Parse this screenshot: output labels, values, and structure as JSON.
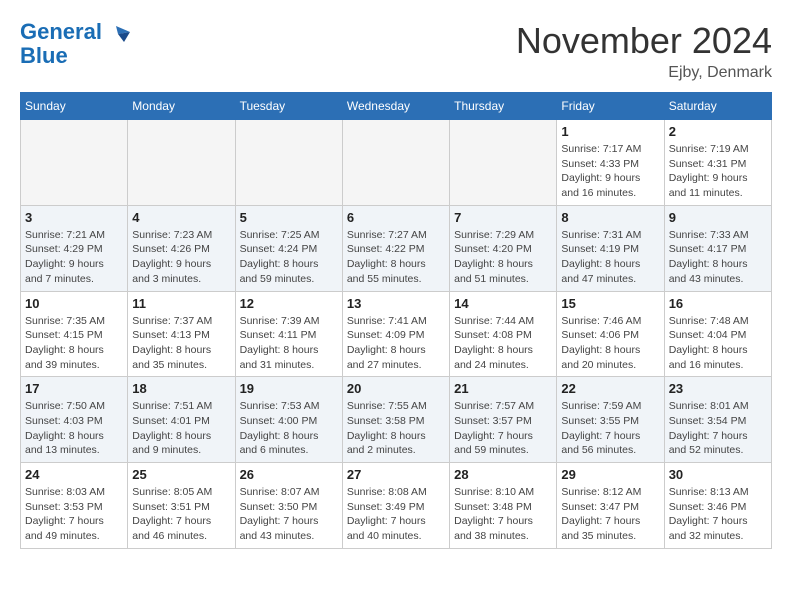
{
  "logo": {
    "line1": "General",
    "line2": "Blue"
  },
  "title": "November 2024",
  "location": "Ejby, Denmark",
  "days_of_week": [
    "Sunday",
    "Monday",
    "Tuesday",
    "Wednesday",
    "Thursday",
    "Friday",
    "Saturday"
  ],
  "weeks": [
    [
      {
        "day": "",
        "info": "",
        "empty": true
      },
      {
        "day": "",
        "info": "",
        "empty": true
      },
      {
        "day": "",
        "info": "",
        "empty": true
      },
      {
        "day": "",
        "info": "",
        "empty": true
      },
      {
        "day": "",
        "info": "",
        "empty": true
      },
      {
        "day": "1",
        "info": "Sunrise: 7:17 AM\nSunset: 4:33 PM\nDaylight: 9 hours and 16 minutes."
      },
      {
        "day": "2",
        "info": "Sunrise: 7:19 AM\nSunset: 4:31 PM\nDaylight: 9 hours and 11 minutes."
      }
    ],
    [
      {
        "day": "3",
        "info": "Sunrise: 7:21 AM\nSunset: 4:29 PM\nDaylight: 9 hours and 7 minutes."
      },
      {
        "day": "4",
        "info": "Sunrise: 7:23 AM\nSunset: 4:26 PM\nDaylight: 9 hours and 3 minutes."
      },
      {
        "day": "5",
        "info": "Sunrise: 7:25 AM\nSunset: 4:24 PM\nDaylight: 8 hours and 59 minutes."
      },
      {
        "day": "6",
        "info": "Sunrise: 7:27 AM\nSunset: 4:22 PM\nDaylight: 8 hours and 55 minutes."
      },
      {
        "day": "7",
        "info": "Sunrise: 7:29 AM\nSunset: 4:20 PM\nDaylight: 8 hours and 51 minutes."
      },
      {
        "day": "8",
        "info": "Sunrise: 7:31 AM\nSunset: 4:19 PM\nDaylight: 8 hours and 47 minutes."
      },
      {
        "day": "9",
        "info": "Sunrise: 7:33 AM\nSunset: 4:17 PM\nDaylight: 8 hours and 43 minutes."
      }
    ],
    [
      {
        "day": "10",
        "info": "Sunrise: 7:35 AM\nSunset: 4:15 PM\nDaylight: 8 hours and 39 minutes."
      },
      {
        "day": "11",
        "info": "Sunrise: 7:37 AM\nSunset: 4:13 PM\nDaylight: 8 hours and 35 minutes."
      },
      {
        "day": "12",
        "info": "Sunrise: 7:39 AM\nSunset: 4:11 PM\nDaylight: 8 hours and 31 minutes."
      },
      {
        "day": "13",
        "info": "Sunrise: 7:41 AM\nSunset: 4:09 PM\nDaylight: 8 hours and 27 minutes."
      },
      {
        "day": "14",
        "info": "Sunrise: 7:44 AM\nSunset: 4:08 PM\nDaylight: 8 hours and 24 minutes."
      },
      {
        "day": "15",
        "info": "Sunrise: 7:46 AM\nSunset: 4:06 PM\nDaylight: 8 hours and 20 minutes."
      },
      {
        "day": "16",
        "info": "Sunrise: 7:48 AM\nSunset: 4:04 PM\nDaylight: 8 hours and 16 minutes."
      }
    ],
    [
      {
        "day": "17",
        "info": "Sunrise: 7:50 AM\nSunset: 4:03 PM\nDaylight: 8 hours and 13 minutes."
      },
      {
        "day": "18",
        "info": "Sunrise: 7:51 AM\nSunset: 4:01 PM\nDaylight: 8 hours and 9 minutes."
      },
      {
        "day": "19",
        "info": "Sunrise: 7:53 AM\nSunset: 4:00 PM\nDaylight: 8 hours and 6 minutes."
      },
      {
        "day": "20",
        "info": "Sunrise: 7:55 AM\nSunset: 3:58 PM\nDaylight: 8 hours and 2 minutes."
      },
      {
        "day": "21",
        "info": "Sunrise: 7:57 AM\nSunset: 3:57 PM\nDaylight: 7 hours and 59 minutes."
      },
      {
        "day": "22",
        "info": "Sunrise: 7:59 AM\nSunset: 3:55 PM\nDaylight: 7 hours and 56 minutes."
      },
      {
        "day": "23",
        "info": "Sunrise: 8:01 AM\nSunset: 3:54 PM\nDaylight: 7 hours and 52 minutes."
      }
    ],
    [
      {
        "day": "24",
        "info": "Sunrise: 8:03 AM\nSunset: 3:53 PM\nDaylight: 7 hours and 49 minutes."
      },
      {
        "day": "25",
        "info": "Sunrise: 8:05 AM\nSunset: 3:51 PM\nDaylight: 7 hours and 46 minutes."
      },
      {
        "day": "26",
        "info": "Sunrise: 8:07 AM\nSunset: 3:50 PM\nDaylight: 7 hours and 43 minutes."
      },
      {
        "day": "27",
        "info": "Sunrise: 8:08 AM\nSunset: 3:49 PM\nDaylight: 7 hours and 40 minutes."
      },
      {
        "day": "28",
        "info": "Sunrise: 8:10 AM\nSunset: 3:48 PM\nDaylight: 7 hours and 38 minutes."
      },
      {
        "day": "29",
        "info": "Sunrise: 8:12 AM\nSunset: 3:47 PM\nDaylight: 7 hours and 35 minutes."
      },
      {
        "day": "30",
        "info": "Sunrise: 8:13 AM\nSunset: 3:46 PM\nDaylight: 7 hours and 32 minutes."
      }
    ]
  ]
}
